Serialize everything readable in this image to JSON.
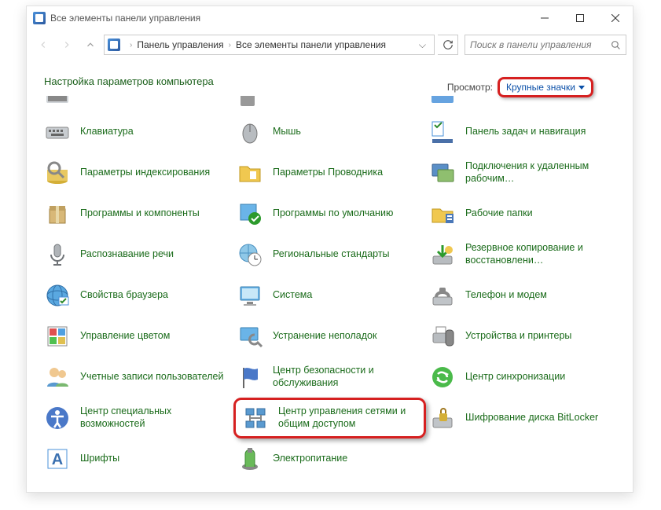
{
  "titlebar": {
    "text": "Все элементы панели управления"
  },
  "breadcrumb": {
    "part1": "Панель управления",
    "part2": "Все элементы панели управления"
  },
  "search": {
    "placeholder": "Поиск в панели управления"
  },
  "content": {
    "title": "Настройка параметров компьютера"
  },
  "view": {
    "label": "Просмотр:",
    "current": "Крупные значки"
  },
  "items": {
    "keyboard": "Клавиатура",
    "mouse": "Мышь",
    "taskbar": "Панель задач и навигация",
    "indexing": "Параметры индексирования",
    "explorer": "Параметры Проводника",
    "remote": "Подключения к удаленным рабочим…",
    "programs": "Программы и компоненты",
    "defaults": "Программы по умолчанию",
    "workfolders": "Рабочие папки",
    "speech": "Распознавание речи",
    "regional": "Региональные стандарты",
    "backup": "Резервное копирование и восстановлени…",
    "browser": "Свойства браузера",
    "system": "Система",
    "phone": "Телефон и модем",
    "color": "Управление цветом",
    "troubleshoot": "Устранение неполадок",
    "devices": "Устройства и принтеры",
    "users": "Учетные записи пользователей",
    "security": "Центр безопасности и обслуживания",
    "sync": "Центр синхронизации",
    "ease": "Центр специальных возможностей",
    "network": "Центр управления сетями и общим доступом",
    "bitlocker": "Шифрование диска BitLocker",
    "fonts": "Шрифты",
    "power": "Электропитание"
  }
}
